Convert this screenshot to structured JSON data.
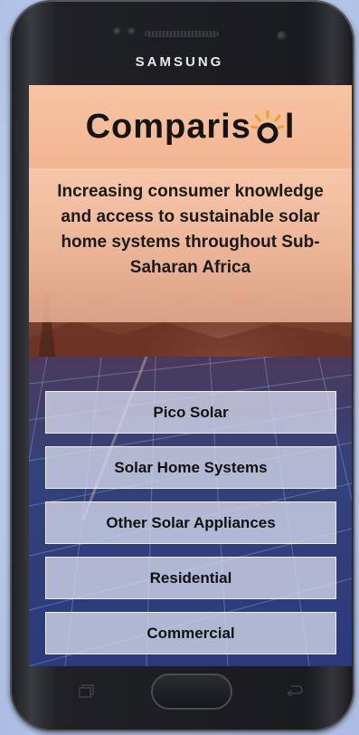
{
  "device": {
    "brand": "SAMSUNG"
  },
  "app": {
    "logo_text": "Comparis",
    "logo_tail": "l",
    "logo_icon": "sun-o-icon",
    "tagline": "Increasing consumer knowledge and access to sustainable solar home systems throughout Sub-Saharan Africa"
  },
  "menu": {
    "items": [
      {
        "label": "Pico Solar"
      },
      {
        "label": "Solar Home Systems"
      },
      {
        "label": "Other Solar Appliances"
      },
      {
        "label": "Residential"
      },
      {
        "label": "Commercial"
      }
    ]
  },
  "nav": {
    "recents_icon": "recent-apps-icon",
    "back_icon": "back-icon"
  }
}
